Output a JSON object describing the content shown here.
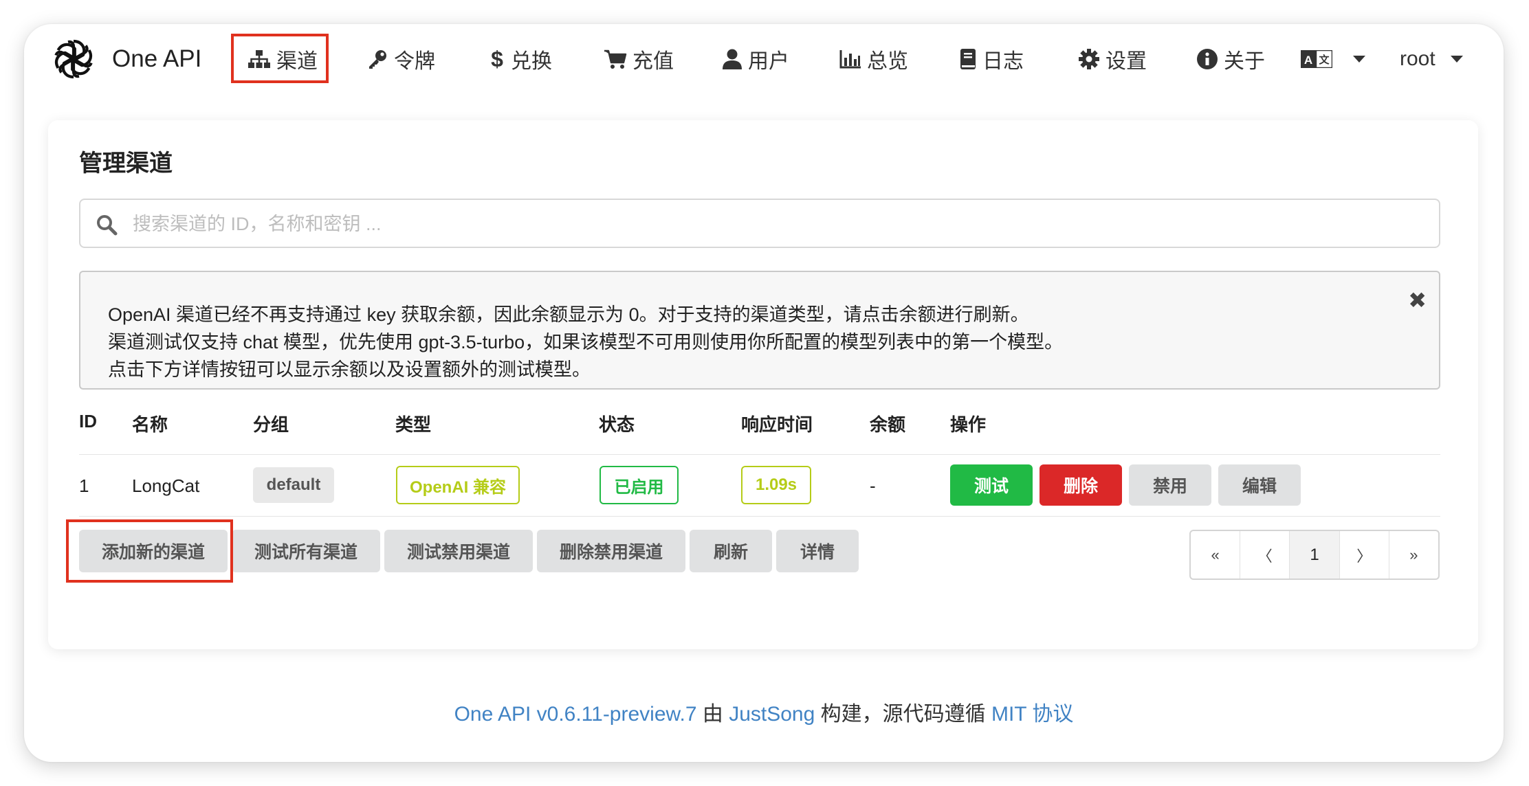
{
  "nav": {
    "brand": "One API",
    "items": [
      {
        "label": "渠道",
        "icon": "sitemap-icon"
      },
      {
        "label": "令牌",
        "icon": "key-icon"
      },
      {
        "label": "兑换",
        "icon": "dollar-icon"
      },
      {
        "label": "充值",
        "icon": "cart-icon"
      },
      {
        "label": "用户",
        "icon": "user-icon"
      },
      {
        "label": "总览",
        "icon": "bar-chart-icon"
      },
      {
        "label": "日志",
        "icon": "book-icon"
      },
      {
        "label": "设置",
        "icon": "gear-icon"
      },
      {
        "label": "关于",
        "icon": "info-icon"
      }
    ],
    "language_icon": "translate-icon",
    "user": "root"
  },
  "page": {
    "title": "管理渠道",
    "search_placeholder": "搜索渠道的 ID，名称和密钥 ...",
    "notice": [
      "OpenAI 渠道已经不再支持通过 key 获取余额，因此余额显示为 0。对于支持的渠道类型，请点击余额进行刷新。",
      "渠道测试仅支持 chat 模型，优先使用 gpt-3.5-turbo，如果该模型不可用则使用你所配置的模型列表中的第一个模型。",
      "点击下方详情按钮可以显示余额以及设置额外的测试模型。"
    ]
  },
  "table": {
    "headers": [
      "ID",
      "名称",
      "分组",
      "类型",
      "状态",
      "响应时间",
      "余额",
      "操作"
    ],
    "rows": [
      {
        "id": "1",
        "name": "LongCat",
        "group": "default",
        "type": "OpenAI 兼容",
        "status": "已启用",
        "response_time": "1.09s",
        "balance": "-",
        "actions": {
          "test": "测试",
          "delete": "删除",
          "disable": "禁用",
          "edit": "编辑"
        }
      }
    ]
  },
  "bottom_buttons": {
    "add": "添加新的渠道",
    "test_all": "测试所有渠道",
    "test_disabled": "测试禁用渠道",
    "delete_disabled": "删除禁用渠道",
    "refresh": "刷新",
    "details": "详情"
  },
  "pagination": {
    "first": "«",
    "prev": "〈",
    "page": "1",
    "next": "〉",
    "last": "»"
  },
  "footer": {
    "version_link": "One API v0.6.11-preview.7",
    "by": " 由 ",
    "author_link": "JustSong",
    "built": " 构建，源代码遵循 ",
    "license_link": "MIT 协议"
  },
  "colors": {
    "highlight": "#e0311e",
    "green": "#21ba45",
    "red": "#db2828",
    "olive": "#b5cc18",
    "link": "#4183c4"
  }
}
